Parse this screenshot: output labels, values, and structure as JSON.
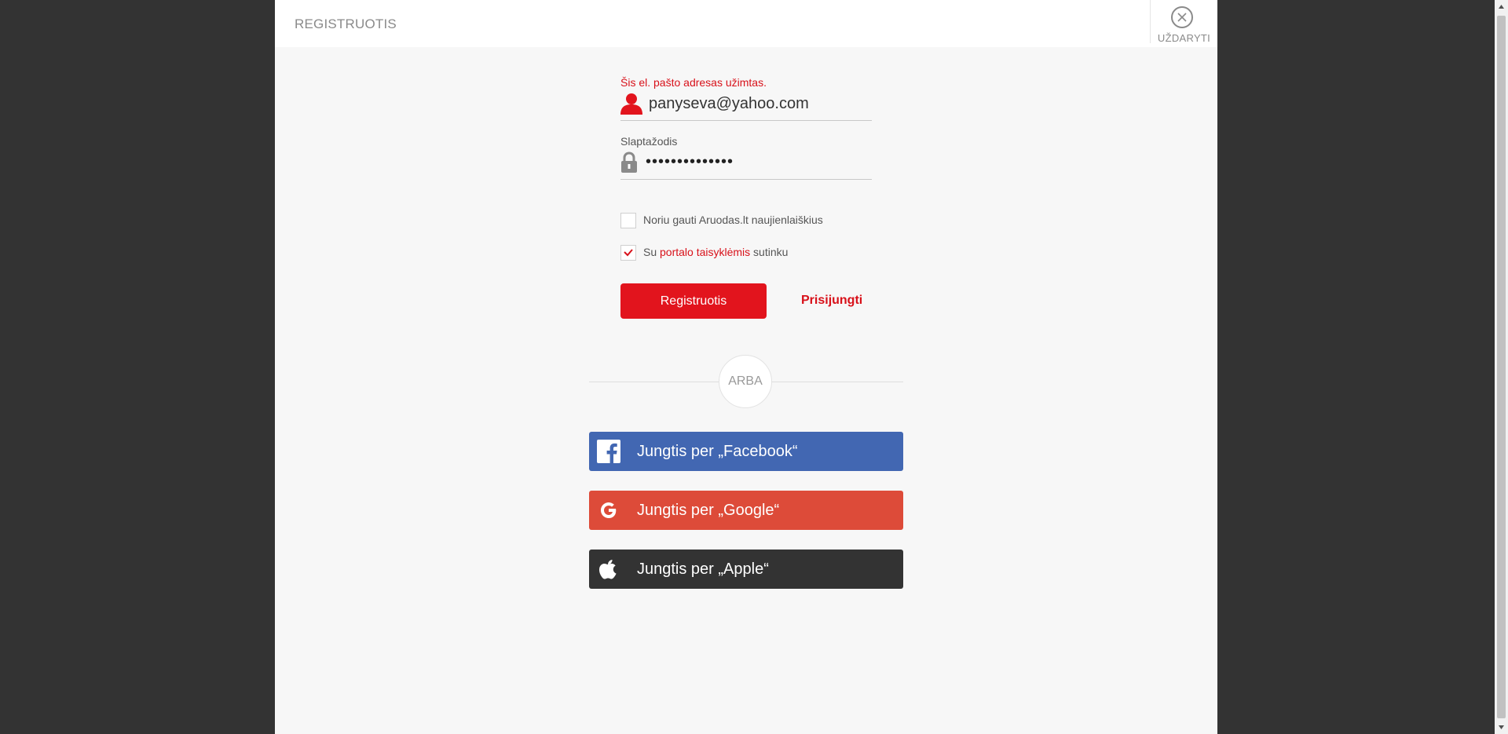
{
  "header": {
    "title": "REGISTRUOTIS",
    "close_label": "UŽDARYTI"
  },
  "form": {
    "error_message": "Šis el. pašto adresas užimtas.",
    "email_value": "panyseva@yahoo.com",
    "password_label": "Slaptažodis",
    "password_value": "••••••••••••••",
    "newsletter_label": "Noriu gauti Aruodas.lt naujienlaiškius",
    "newsletter_checked": false,
    "terms_prefix": "Su ",
    "terms_link": "portalo taisyklėmis",
    "terms_suffix": " sutinku",
    "terms_checked": true,
    "register_button": "Registruotis",
    "login_link": "Prisijungti"
  },
  "divider": {
    "label": "ARBA"
  },
  "social": {
    "facebook": "Jungtis per „Facebook“",
    "google": "Jungtis per „Google“",
    "apple": "Jungtis per „Apple“"
  },
  "colors": {
    "accent_red": "#e2141d",
    "facebook_blue": "#4267b2",
    "google_red": "#dd4b39",
    "apple_dark": "#333333"
  },
  "icons": {
    "close": "close-icon",
    "email": "user-icon",
    "password": "lock-icon",
    "checkmark": "checkmark-icon",
    "facebook": "facebook-icon",
    "google": "google-icon",
    "apple": "apple-icon"
  }
}
